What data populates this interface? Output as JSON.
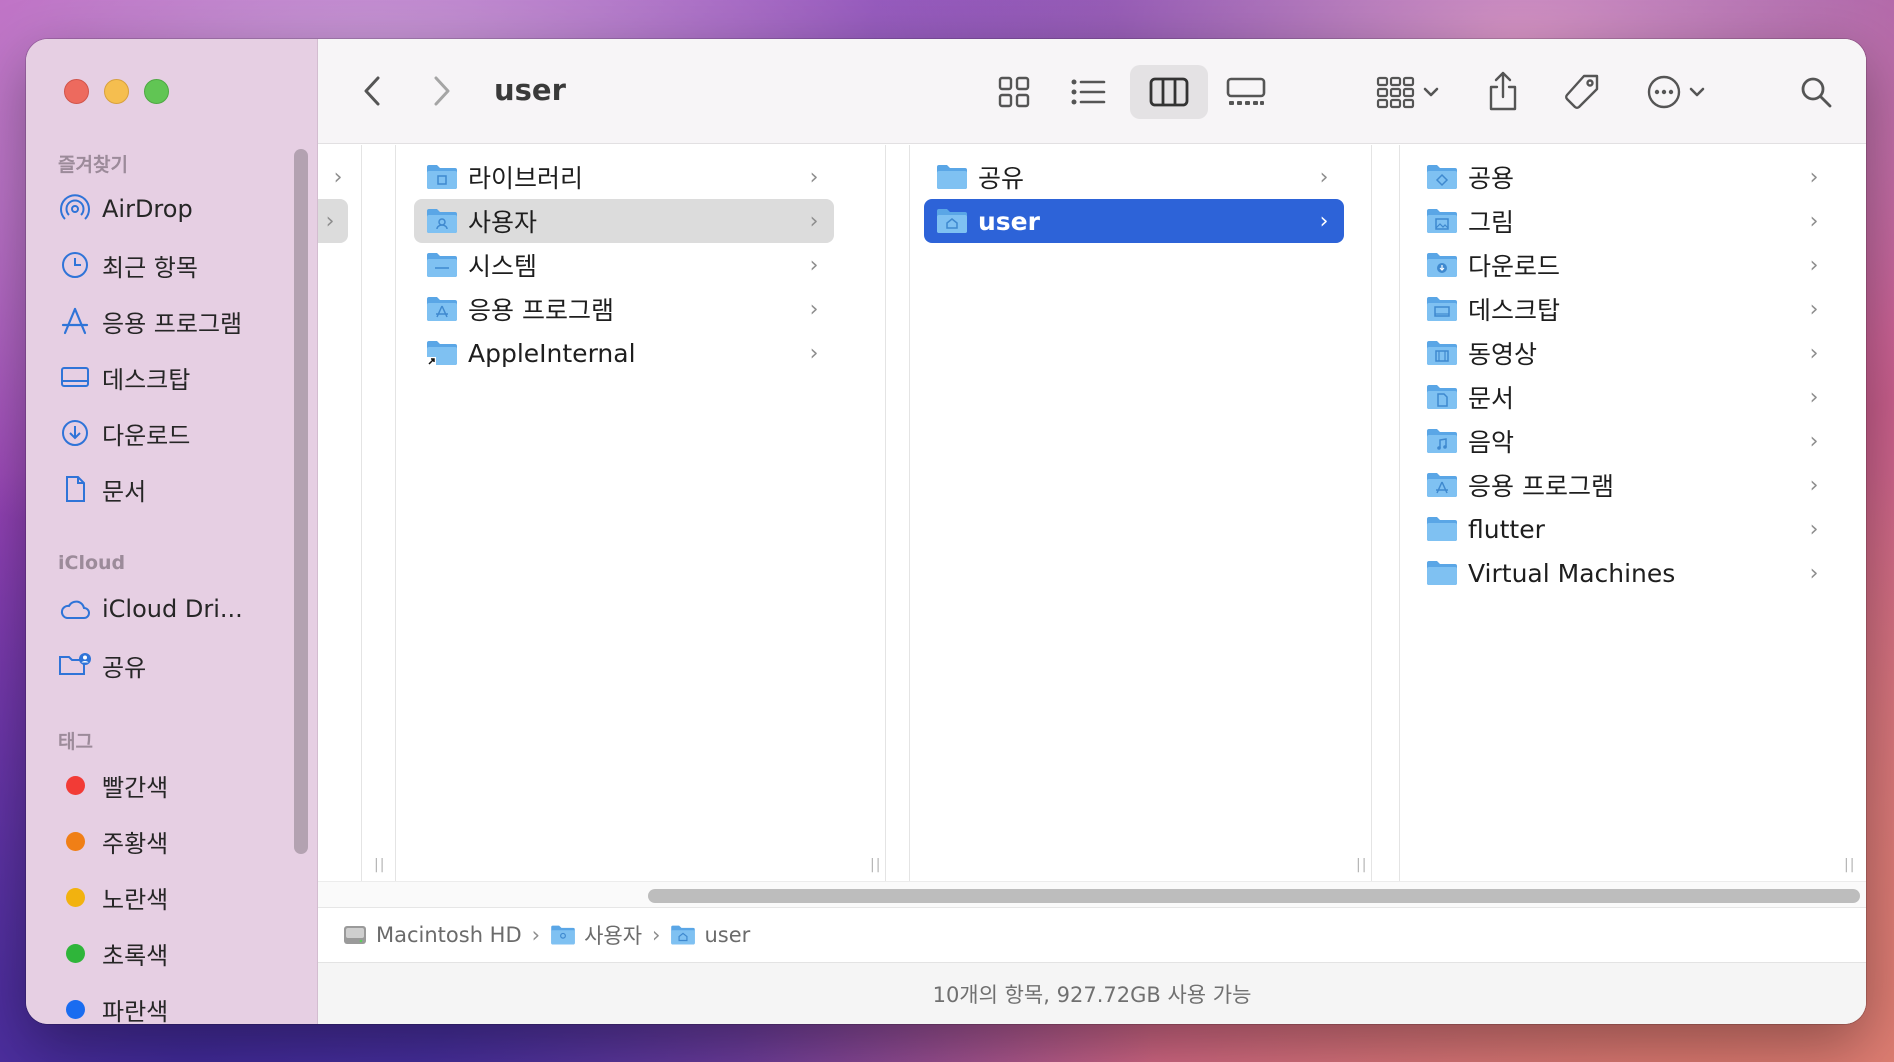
{
  "window": {
    "title": "user"
  },
  "sidebar": {
    "favorites_header": "즐겨찾기",
    "favorites": [
      {
        "label": "AirDrop",
        "icon": "airdrop-icon"
      },
      {
        "label": "최근 항목",
        "icon": "clock-icon"
      },
      {
        "label": "응용 프로그램",
        "icon": "applications-icon"
      },
      {
        "label": "데스크탑",
        "icon": "desktop-icon"
      },
      {
        "label": "다운로드",
        "icon": "download-icon"
      },
      {
        "label": "문서",
        "icon": "document-icon"
      }
    ],
    "icloud_header": "iCloud",
    "icloud": [
      {
        "label": "iCloud Dri...",
        "icon": "cloud-icon"
      },
      {
        "label": "공유",
        "icon": "shared-folder-icon"
      }
    ],
    "tags_header": "태그",
    "tags": [
      {
        "label": "빨간색",
        "color": "#f23b36"
      },
      {
        "label": "주황색",
        "color": "#f07f16"
      },
      {
        "label": "노란색",
        "color": "#f2b20f"
      },
      {
        "label": "초록색",
        "color": "#2fb53a"
      },
      {
        "label": "파란색",
        "color": "#1a6cf0"
      }
    ]
  },
  "columns": {
    "col1": [
      {
        "name": "라이브러리",
        "icon": "library-folder-icon"
      },
      {
        "name": "사용자",
        "icon": "users-folder-icon"
      },
      {
        "name": "시스템",
        "icon": "system-folder-icon"
      },
      {
        "name": "응용 프로그램",
        "icon": "applications-folder-icon"
      },
      {
        "name": "AppleInternal",
        "icon": "alias-folder-icon"
      }
    ],
    "col2": [
      {
        "name": "공유",
        "icon": "folder-icon"
      },
      {
        "name": "user",
        "icon": "home-folder-icon"
      }
    ],
    "col3": [
      {
        "name": "공용",
        "icon": "public-folder-icon"
      },
      {
        "name": "그림",
        "icon": "pictures-folder-icon"
      },
      {
        "name": "다운로드",
        "icon": "downloads-folder-icon"
      },
      {
        "name": "데스크탑",
        "icon": "desktop-folder-icon"
      },
      {
        "name": "동영상",
        "icon": "movies-folder-icon"
      },
      {
        "name": "문서",
        "icon": "documents-folder-icon"
      },
      {
        "name": "음악",
        "icon": "music-folder-icon"
      },
      {
        "name": "응용 프로그램",
        "icon": "applications-folder-icon"
      },
      {
        "name": "flutter",
        "icon": "folder-icon"
      },
      {
        "name": "Virtual Machines",
        "icon": "folder-icon"
      }
    ]
  },
  "pathbar": {
    "segments": [
      "Macintosh HD",
      "사용자",
      "user"
    ]
  },
  "status": {
    "text": "10개의 항목, 927.72GB 사용 가능"
  },
  "colors": {
    "selection_blue": "#2d63d8",
    "sidebar_bg": "#e6cfe3",
    "folder_blue": "#6fb5ec"
  }
}
